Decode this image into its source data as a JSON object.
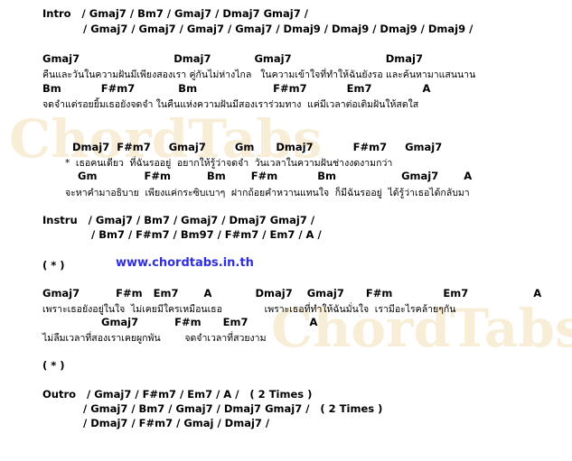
{
  "watermark": {
    "left": "ChordTabs",
    "right": "ChordTabs"
  },
  "lines": [
    {
      "kind": "chord",
      "text": "Intro   / Gmaj7 / Bm7 / Gmaj7 / Dmaj7 Gmaj7 /"
    },
    {
      "kind": "chord",
      "text": "/ Gmaj7 / Gmaj7 / Gmaj7 / Gmaj7 / Dmaj9 / Dmaj9 / Dmaj9 / Dmaj9 /"
    },
    {
      "kind": "chord",
      "text": "Gmaj7                          Dmaj7            Gmaj7                          Dmaj7"
    },
    {
      "kind": "lyric",
      "text": "คืนและวันในความฝันมีเพียงสองเรา คู่กันไม่ห่างไกล   ในความเข้าใจที่ทำให้ฉันยังรอ และค้นหามาแสนนาน"
    },
    {
      "kind": "chord",
      "text": "Bm           F#m7            Bm                     F#m7           Em7              A"
    },
    {
      "kind": "lyric",
      "text": "จดจำแต่รอยยิ้มเธอยังจดจำ ในคืนแห่งความฝันมีสองเราร่วมทาง  แค่มีเวลาต่อเติมฝันให้สดใส"
    },
    {
      "kind": "chord",
      "text": "Dmaj7  F#m7     Gmaj7        Gm      Dmaj7           F#m7     Gmaj7"
    },
    {
      "kind": "lyric",
      "text": "*  เธอคนเดียว  ที่ฉันรออยู่  อยากให้รู้ว่าจดจำ  วันเวลาในความฝันช่างงดงามกว่า"
    },
    {
      "kind": "chord",
      "text": "Gm             F#m          Bm       F#m           Bm                  Gmaj7       A"
    },
    {
      "kind": "lyric",
      "text": "จะหาคำมาอธิบาย  เพียงแค่กระซิบเบาๆ  ฝากถ้อยคำหวานแทนใจ  ก็มีฉันรออยู่  ได้รู้ว่าเธอได้กลับมา"
    },
    {
      "kind": "chord",
      "text": "Instru   / Gmaj7 / Bm7 / Gmaj7 / Dmaj7 Gmaj7 /"
    },
    {
      "kind": "chord",
      "text": "/ Bm7 / F#m7 / Bm97 / F#m7 / Em7 / A /"
    },
    {
      "kind": "chord",
      "text": "( * )"
    },
    {
      "kind": "url",
      "text": "www.chordtabs.in.th"
    },
    {
      "kind": "chord",
      "text": "Gmaj7          F#m   Em7       A            Dmaj7    Gmaj7      F#m              Em7                  A"
    },
    {
      "kind": "lyric",
      "text": "เพราะเธอยังอยู่ในใจ  ไม่เคยมีใครเหมือนเธอ              เพราะเธอที่ทำให้ฉันมั่นใจ  เรามีอะไรคล้ายๆกัน"
    },
    {
      "kind": "chord",
      "text": "Gmaj7          F#m      Em7                 A"
    },
    {
      "kind": "lyric",
      "text": "ไม่ลืมเวลาที่สองเราเคยผูกพัน        จดจำเวลาที่สวยงาม"
    },
    {
      "kind": "chord",
      "text": "( * )"
    },
    {
      "kind": "chord",
      "text": "Outro   / Gmaj7 / F#m7 / Em7 / A /   ( 2 Times )"
    },
    {
      "kind": "chord",
      "text": "/ Gmaj7 / Bm7 / Gmaj7 / Dmaj7 Gmaj7 /   ( 2 Times )"
    },
    {
      "kind": "chord",
      "text": "/ Dmaj7 / F#m7 / Gmaj / Dmaj7 /"
    }
  ]
}
